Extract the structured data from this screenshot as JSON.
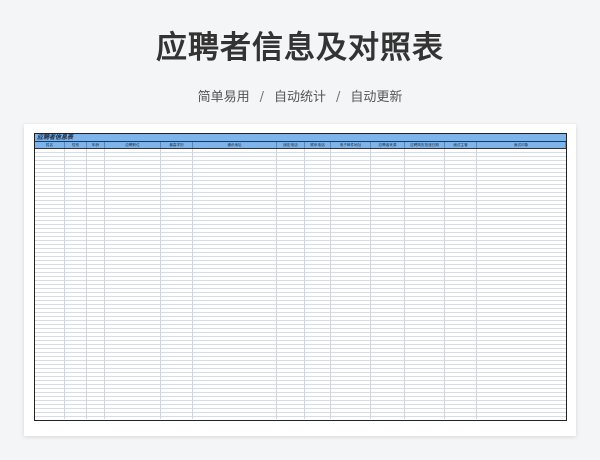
{
  "header": {
    "title": "应聘者信息及对照表",
    "features": [
      "简单易用",
      "自动统计",
      "自动更新"
    ],
    "separator": "/"
  },
  "sheet": {
    "title": "应聘者信息表",
    "columns": [
      {
        "label": "姓名",
        "w": 30
      },
      {
        "label": "性别",
        "w": 22
      },
      {
        "label": "年龄",
        "w": 18
      },
      {
        "label": "应聘职位",
        "w": 56
      },
      {
        "label": "最高学历",
        "w": 32
      },
      {
        "label": "通讯地址",
        "w": 84
      },
      {
        "label": "固定电话",
        "w": 28
      },
      {
        "label": "联系电话",
        "w": 26
      },
      {
        "label": "电子邮件地址",
        "w": 40
      },
      {
        "label": "应聘者来源",
        "w": 34
      },
      {
        "label": "应聘简历投递日期",
        "w": 40
      },
      {
        "label": "面试主管",
        "w": 32
      },
      {
        "label": "面试印象",
        "w": 89
      }
    ]
  },
  "colors": {
    "header_fill": "#7fb4ea",
    "grid_line": "#d9dde3"
  }
}
